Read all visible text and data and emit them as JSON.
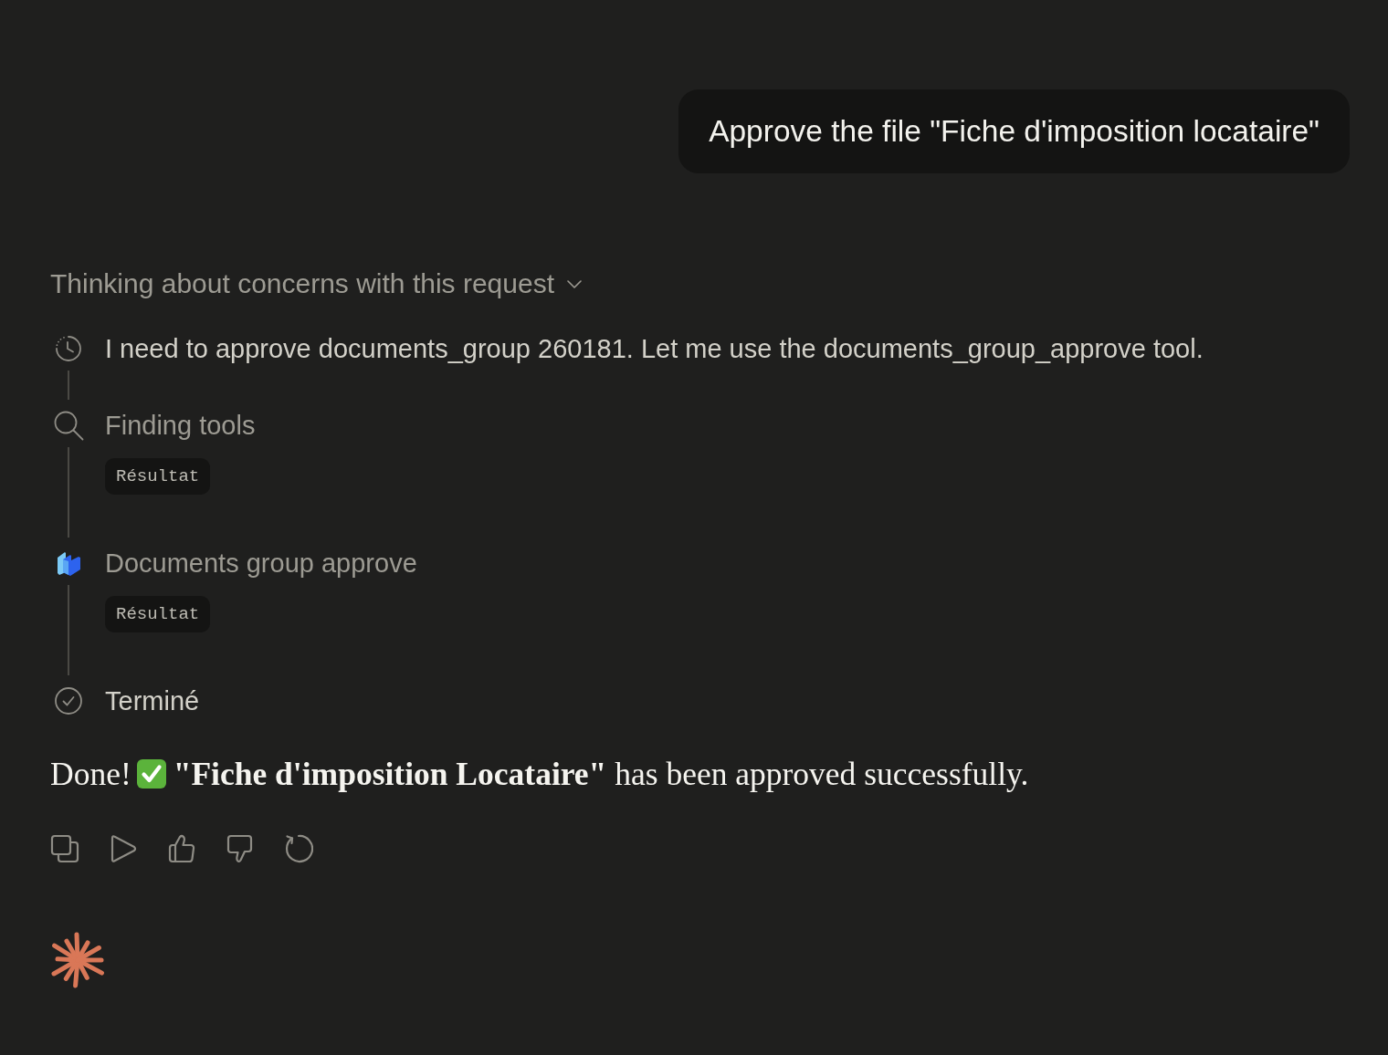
{
  "user_message": {
    "text": "Approve the file \"Fiche d'imposition locataire\""
  },
  "thinking": {
    "title": "Thinking about concerns with this request"
  },
  "steps": [
    {
      "kind": "thought",
      "text": "I need to approve documents_group 260181. Let me use the documents_group_approve tool."
    },
    {
      "kind": "search",
      "text": "Finding tools",
      "result": "Résultat"
    },
    {
      "kind": "tool",
      "text": "Documents group approve",
      "result": "Résultat"
    },
    {
      "kind": "done",
      "text": "Terminé"
    }
  ],
  "response": {
    "lead": "Done!",
    "text": "**\"Fiche d'imposition Locataire\"** has been approved successfully."
  }
}
